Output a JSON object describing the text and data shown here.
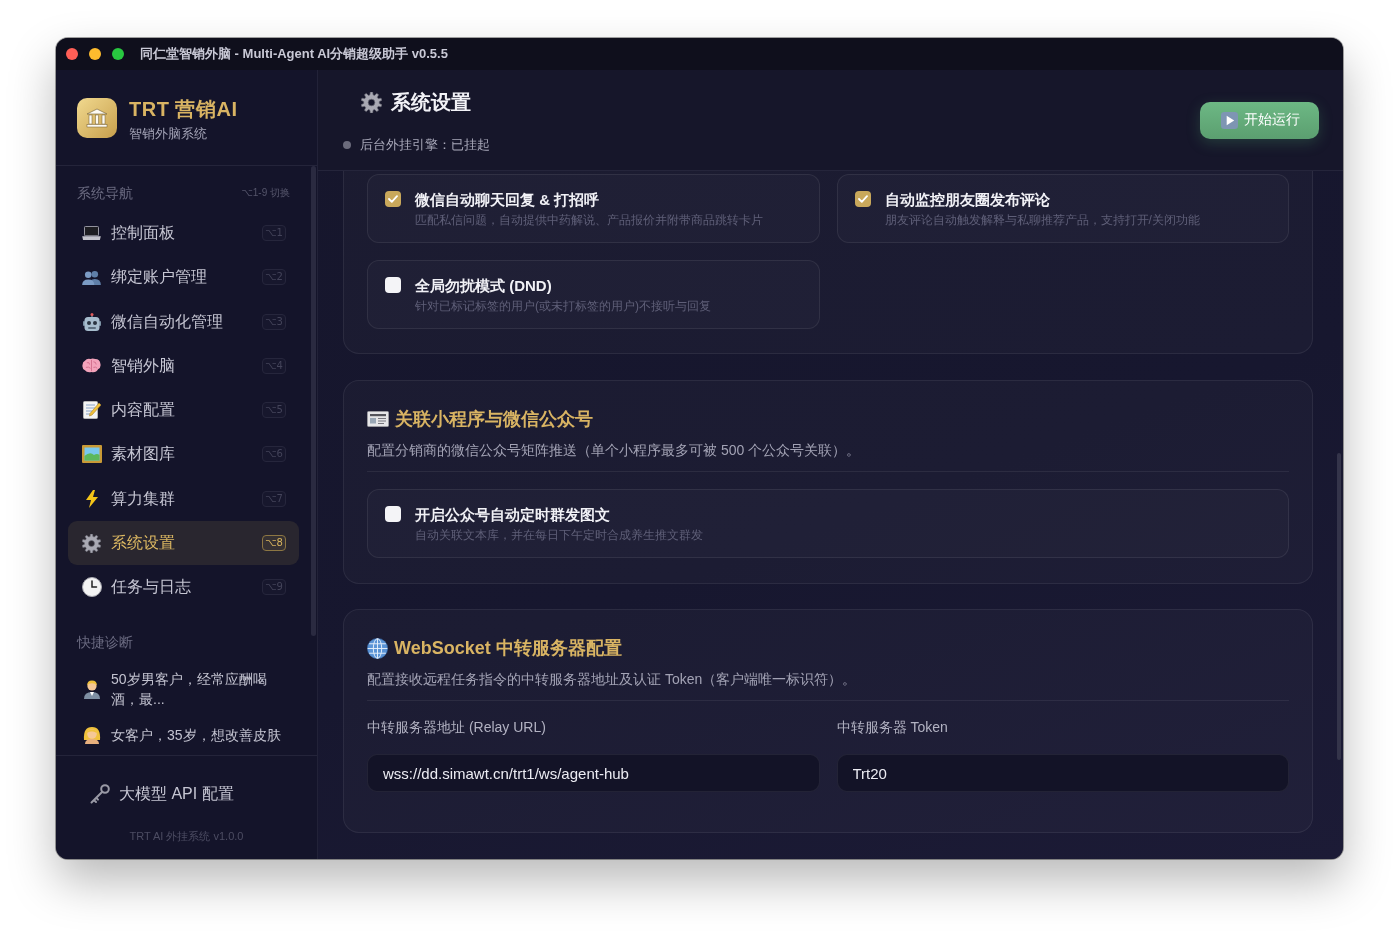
{
  "window": {
    "title": "同仁堂智销外脑 - Multi-Agent AI分销超级助手 v0.5.5"
  },
  "sidebar": {
    "brand": {
      "name": "TRT 营销AI",
      "subtitle": "智销外脑系统"
    },
    "nav_heading": "系统导航",
    "nav_hint": "⌥1-9 切换",
    "nav_items": [
      {
        "label": "控制面板",
        "shortcut": "⌥1",
        "selected": false
      },
      {
        "label": "绑定账户管理",
        "shortcut": "⌥2",
        "selected": false
      },
      {
        "label": "微信自动化管理",
        "shortcut": "⌥3",
        "selected": false
      },
      {
        "label": "智销外脑",
        "shortcut": "⌥4",
        "selected": false
      },
      {
        "label": "内容配置",
        "shortcut": "⌥5",
        "selected": false
      },
      {
        "label": "素材图库",
        "shortcut": "⌥6",
        "selected": false
      },
      {
        "label": "算力集群",
        "shortcut": "⌥7",
        "selected": false
      },
      {
        "label": "系统设置",
        "shortcut": "⌥8",
        "selected": true
      },
      {
        "label": "任务与日志",
        "shortcut": "⌥9",
        "selected": false
      }
    ],
    "quick_heading": "快捷诊断",
    "quick_items": [
      {
        "text": "50岁男客户，经常应酬喝酒，最..."
      },
      {
        "text": "女客户，35岁，想改善皮肤"
      }
    ],
    "api_config": "大模型 API 配置",
    "version": "TRT AI 外挂系统 v1.0.0"
  },
  "main": {
    "header": {
      "title": "系统设置",
      "status": {
        "text": "后台外挂引擎：已挂起",
        "running": false
      },
      "run_button": "开始运行"
    },
    "sections": [
      {
        "options": [
          {
            "title": "微信自动聊天回复 & 打招呼",
            "description": "匹配私信问题，自动提供中药解说、产品报价并附带商品跳转卡片",
            "checked": true
          },
          {
            "title": "自动监控朋友圈发布评论",
            "description": "朋友评论自动触发解释与私聊推荐产品，支持打开/关闭功能",
            "checked": true
          },
          {
            "title": "全局勿扰模式 (DND)",
            "description": "针对已标记标签的用户(或未打标签的用户)不接听与回复",
            "checked": false
          }
        ]
      },
      {
        "title": "关联小程序与微信公众号",
        "description": "配置分销商的微信公众号矩阵推送（单个小程序最多可被 500 个公众号关联）。",
        "options": [
          {
            "title": "开启公众号自动定时群发图文",
            "description": "自动关联文本库，并在每日下午定时合成养生推文群发",
            "checked": false
          }
        ]
      },
      {
        "title": "WebSocket 中转服务器配置",
        "description": "配置接收远程任务指令的中转服务器地址及认证 Token（客户端唯一标识符）。",
        "fields": [
          {
            "label": "中转服务器地址 (Relay URL)",
            "value": "wss://dd.simawt.cn/trt1/ws/agent-hub"
          },
          {
            "label": "中转服务器 Token",
            "value": "Trt20"
          }
        ]
      }
    ]
  }
}
